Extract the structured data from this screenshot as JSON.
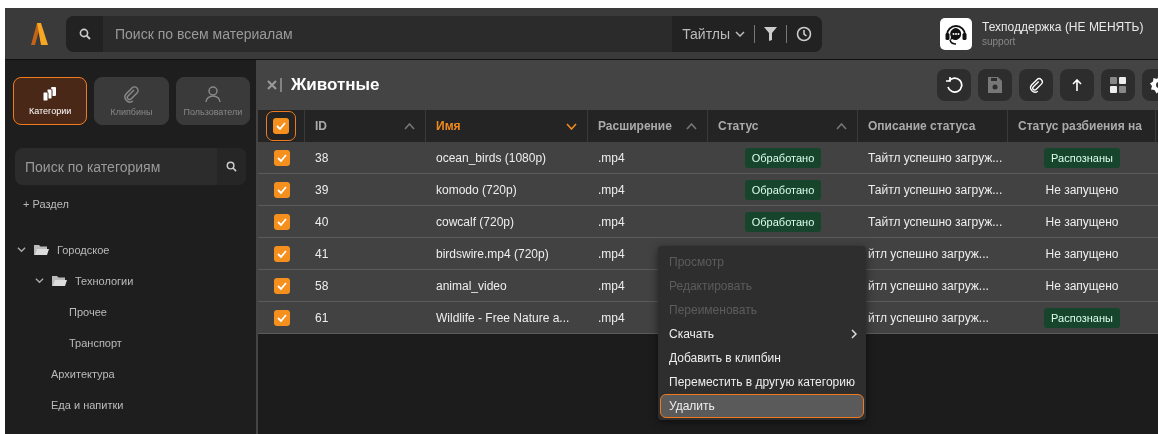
{
  "topbar": {
    "search_placeholder": "Поиск по всем материалам",
    "search_scope": "Тайтлы",
    "user": {
      "name": "Техподдержка (НЕ МЕНЯТЬ)",
      "login": "support"
    }
  },
  "sidebar": {
    "tabs": [
      {
        "label": "Категории",
        "kind": "categories",
        "selected": true
      },
      {
        "label": "Клипбины",
        "kind": "clipbins",
        "selected": false
      },
      {
        "label": "Пользователи",
        "kind": "users",
        "selected": false
      }
    ],
    "search_placeholder": "Поиск по категориям",
    "add_section": "+ Раздел",
    "tree": [
      {
        "label": "Городское",
        "expanded": true,
        "children": [
          {
            "label": "Технологии",
            "expanded": true,
            "children": [
              {
                "label": "Прочее"
              },
              {
                "label": "Транспорт"
              }
            ]
          },
          {
            "label": "Архитектура"
          },
          {
            "label": "Еда и напитки"
          }
        ]
      }
    ]
  },
  "content": {
    "title": "Животные",
    "table": {
      "all_checked": true,
      "columns": [
        {
          "label": "ID",
          "sortable": true,
          "sort_descending": false,
          "selected": false
        },
        {
          "label": "Имя",
          "sortable": true,
          "sort_descending": true,
          "selected": true
        },
        {
          "label": "Расширение",
          "sortable": true,
          "sort_descending": false,
          "selected": false
        },
        {
          "label": "Статус",
          "sortable": true,
          "sort_descending": false,
          "selected": false
        },
        {
          "label": "Описание статуса",
          "sortable": false,
          "selected": false
        },
        {
          "label": "Статус разбиения на",
          "sortable": false,
          "selected": false
        }
      ],
      "rows": [
        {
          "checked": true,
          "id": "38",
          "name": "ocean_birds (1080p)",
          "ext": ".mp4",
          "status": "Обработано",
          "description": "Тайтл успешно загруж...",
          "split": {
            "text": "Распознаны",
            "kind": "badge"
          }
        },
        {
          "checked": true,
          "id": "39",
          "name": "komodo (720p)",
          "ext": ".mp4",
          "status": "Обработано",
          "description": "Тайтл успешно загруж...",
          "split": {
            "text": "Не запущено",
            "kind": "plain"
          }
        },
        {
          "checked": true,
          "id": "40",
          "name": "cowcalf (720p)",
          "ext": ".mp4",
          "status": "Обработано",
          "description": "Тайтл успешно загруж...",
          "split": {
            "text": "Не запущено",
            "kind": "plain"
          }
        },
        {
          "checked": true,
          "id": "41",
          "name": "birdswire.mp4 (720p)",
          "ext": ".mp4",
          "description": "йтл успешно загруж...",
          "split": {
            "text": "Не запущено",
            "kind": "plain"
          }
        },
        {
          "checked": true,
          "id": "58",
          "name": "animal_video",
          "ext": ".mp4",
          "description": "йтл успешно загруж...",
          "split": {
            "text": "Не запущено",
            "kind": "plain"
          }
        },
        {
          "checked": true,
          "id": "61",
          "name": "Wildlife - Free Nature a...",
          "ext": ".mp4",
          "description": "йтл успешно загруж...",
          "split": {
            "text": "Распознаны",
            "kind": "badge"
          }
        }
      ]
    }
  },
  "context_menu": {
    "items": [
      {
        "label": "Просмотр",
        "disabled": true,
        "submenu": false,
        "highlighted": false
      },
      {
        "label": "Редактировать",
        "disabled": true,
        "submenu": false,
        "highlighted": false
      },
      {
        "label": "Переименовать",
        "disabled": true,
        "submenu": false,
        "highlighted": false
      },
      {
        "label": "Скачать",
        "disabled": false,
        "submenu": true,
        "highlighted": false
      },
      {
        "label": "Добавить в клипбин",
        "disabled": false,
        "submenu": false,
        "highlighted": false
      },
      {
        "label": "Переместить в другую категорию",
        "disabled": false,
        "submenu": false,
        "highlighted": false
      },
      {
        "label": "Удалить",
        "disabled": false,
        "submenu": false,
        "highlighted": true
      }
    ]
  }
}
